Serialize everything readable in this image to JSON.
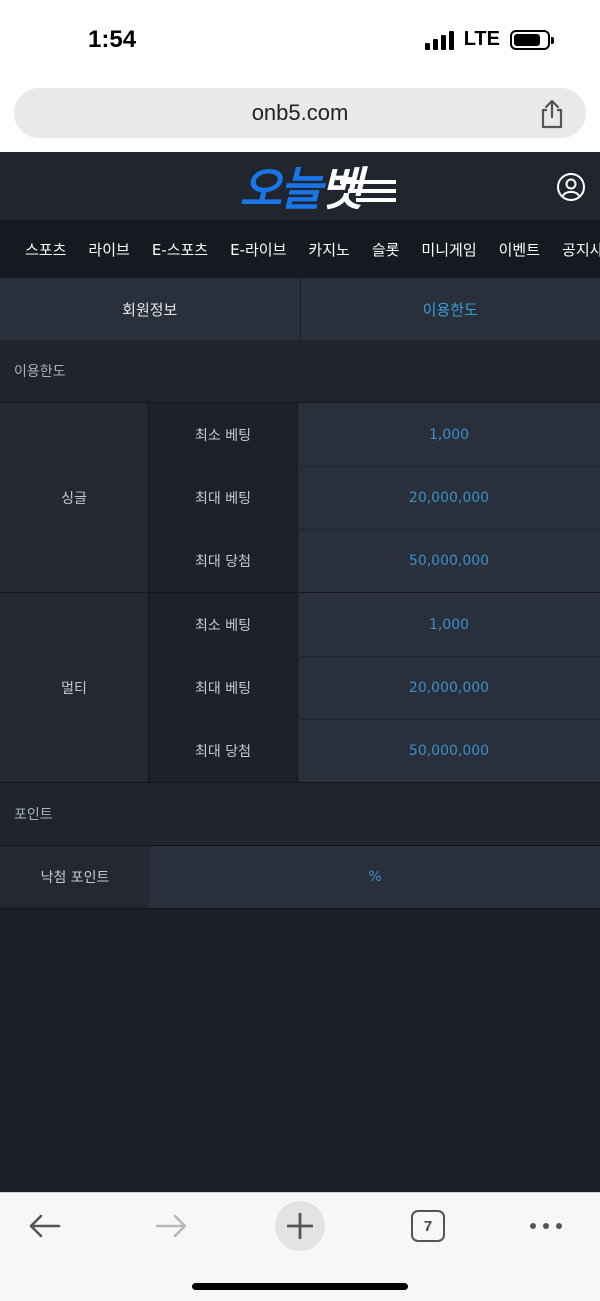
{
  "status": {
    "time": "1:54",
    "network": "LTE"
  },
  "browser": {
    "url": "onb5.com",
    "open_tabs": "7"
  },
  "site": {
    "logo": {
      "main": "오늘",
      "accent": "벳"
    },
    "nav": [
      "스포츠",
      "라이브",
      "E-스포츠",
      "E-라이브",
      "카지노",
      "슬롯",
      "미니게임",
      "이벤트",
      "공지사항"
    ],
    "tabs": [
      {
        "label": "회원정보",
        "active": false
      },
      {
        "label": "이용한도",
        "active": true
      }
    ],
    "limits": {
      "title": "이용한도",
      "groups": [
        {
          "label": "싱글",
          "rows": [
            {
              "label": "최소 베팅",
              "value": "1,000"
            },
            {
              "label": "최대 베팅",
              "value": "20,000,000"
            },
            {
              "label": "최대 당첨",
              "value": "50,000,000"
            }
          ]
        },
        {
          "label": "멀티",
          "rows": [
            {
              "label": "최소 베팅",
              "value": "1,000"
            },
            {
              "label": "최대 베팅",
              "value": "20,000,000"
            },
            {
              "label": "최대 당첨",
              "value": "50,000,000"
            }
          ]
        }
      ]
    },
    "points": {
      "title": "포인트",
      "rows": [
        {
          "label": "낙첨 포인트",
          "value": "%"
        }
      ]
    }
  },
  "colors": {
    "accent": "#3a8fc8",
    "logo_blue": "#1976e8",
    "background": "#1b1f27"
  }
}
